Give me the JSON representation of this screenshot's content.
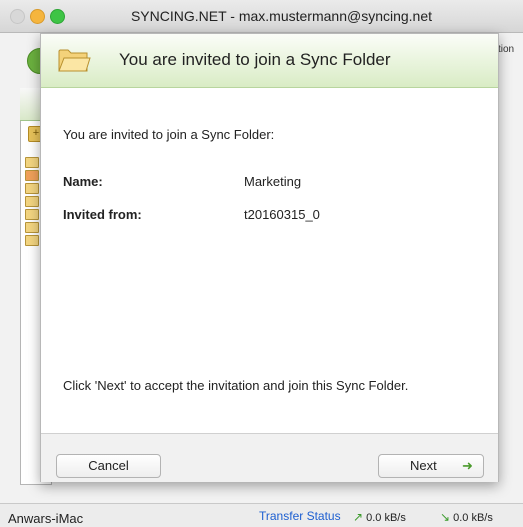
{
  "window": {
    "title": "SYNCING.NET - max.mustermann@syncing.net",
    "right_label": "tion"
  },
  "dialog": {
    "header_title": "You are invited to join a Sync Folder",
    "intro": "You are invited to join a Sync Folder:",
    "fields": [
      {
        "label": "Name:",
        "value": "Marketing"
      },
      {
        "label": "Invited from:",
        "value": "t20160315_0"
      }
    ],
    "hint": "Click 'Next' to accept the invitation and join this Sync Folder.",
    "cancel_label": "Cancel",
    "next_label": "Next"
  },
  "status": {
    "host": "Anwars-iMac",
    "transfer_link": "Transfer Status",
    "upload_rate": "0.0 kB/s",
    "download_rate": "0.0 kB/s"
  },
  "icons": {
    "header": "folder-icon",
    "next": "arrow-right-icon",
    "upload": "arrow-up-right-icon",
    "download": "arrow-down-right-icon"
  }
}
